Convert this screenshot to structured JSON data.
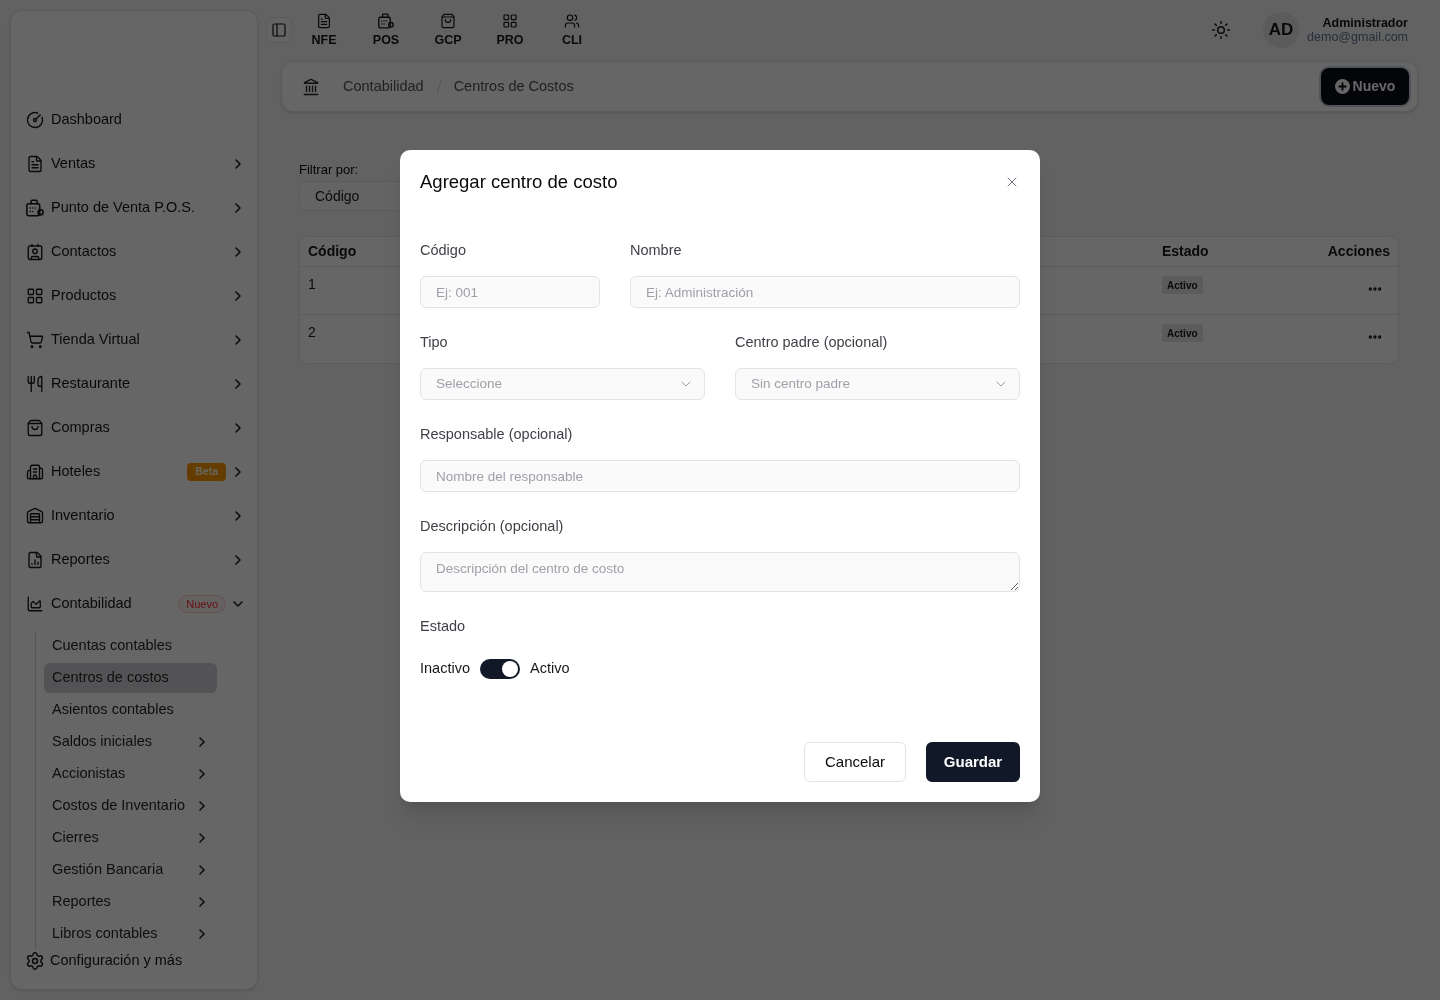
{
  "sidebar": {
    "items": [
      {
        "label": "Dashboard",
        "selected": false
      },
      {
        "label": "Ventas",
        "selected": false,
        "expanded": false
      },
      {
        "label": "Punto de Venta P.O.S.",
        "selected": false,
        "expanded": false
      },
      {
        "label": "Contactos",
        "selected": false,
        "expanded": false
      },
      {
        "label": "Productos",
        "selected": false,
        "expanded": false
      },
      {
        "label": "Tienda Virtual",
        "selected": false,
        "expanded": false
      },
      {
        "label": "Restaurante",
        "selected": false,
        "expanded": false
      },
      {
        "label": "Compras",
        "selected": false,
        "expanded": false
      },
      {
        "label": "Hoteles",
        "selected": false,
        "expanded": false,
        "badge": {
          "text": "Beta",
          "kind": "beta"
        }
      },
      {
        "label": "Inventario",
        "selected": false,
        "expanded": false
      },
      {
        "label": "Reportes",
        "selected": false,
        "expanded": false
      },
      {
        "label": "Contabilidad",
        "selected": false,
        "expanded": true,
        "badge": {
          "text": "Nuevo",
          "kind": "new"
        },
        "children": [
          {
            "label": "Cuentas contables",
            "selected": false
          },
          {
            "label": "Centros de costos",
            "selected": true
          },
          {
            "label": "Asientos contables",
            "selected": false
          },
          {
            "label": "Saldos iniciales",
            "selected": false,
            "expanded": false
          },
          {
            "label": "Accionistas",
            "selected": false,
            "expanded": false
          },
          {
            "label": "Costos de Inventario",
            "selected": false,
            "expanded": false
          },
          {
            "label": "Cierres",
            "selected": false,
            "expanded": false
          },
          {
            "label": "Gestión Bancaria",
            "selected": false,
            "expanded": false
          },
          {
            "label": "Reportes",
            "selected": false,
            "expanded": false
          },
          {
            "label": "Libros contables",
            "selected": false,
            "expanded": false
          }
        ]
      }
    ],
    "footer": {
      "label": "Configuración y más"
    }
  },
  "topbar": {
    "quick_links": [
      {
        "label": "NFE"
      },
      {
        "label": "POS"
      },
      {
        "label": "GCP"
      },
      {
        "label": "PRO"
      },
      {
        "label": "CLI"
      }
    ],
    "user": {
      "initials": "AD",
      "name": "Administrador",
      "email": "demo@gmail.com"
    }
  },
  "breadcrumb": {
    "items": [
      "Contabilidad",
      "Centros de Costos"
    ],
    "new_button": "Nuevo"
  },
  "filter": {
    "label": "Filtrar por:",
    "value": "Código"
  },
  "table": {
    "columns": [
      "Código",
      "Estado",
      "Acciones"
    ],
    "rows": [
      {
        "code": "1",
        "status": "Activo"
      },
      {
        "code": "2",
        "status": "Activo"
      }
    ]
  },
  "modal": {
    "title": "Agregar centro de costo",
    "rows": [
      [
        {
          "kind": "input",
          "label": "Código",
          "placeholder": "Ej: 001"
        },
        {
          "kind": "input",
          "label": "Nombre",
          "placeholder": "Ej: Administración"
        }
      ],
      [
        {
          "kind": "select",
          "label": "Tipo",
          "placeholder": "Seleccione"
        },
        {
          "kind": "select",
          "label": "Centro padre (opcional)",
          "placeholder": "Sin centro padre"
        }
      ],
      [
        {
          "kind": "input",
          "label": "Responsable (opcional)",
          "placeholder": "Nombre del responsable"
        }
      ],
      [
        {
          "kind": "textarea",
          "label": "Descripción (opcional)",
          "placeholder": "Descripción del centro de costo"
        }
      ]
    ],
    "status": {
      "label": "Estado",
      "off_label": "Inactivo",
      "on_label": "Activo",
      "on": true
    },
    "buttons": [
      {
        "kind": "secondary",
        "label": "Cancelar"
      },
      {
        "kind": "primary",
        "label": "Guardar"
      }
    ]
  }
}
